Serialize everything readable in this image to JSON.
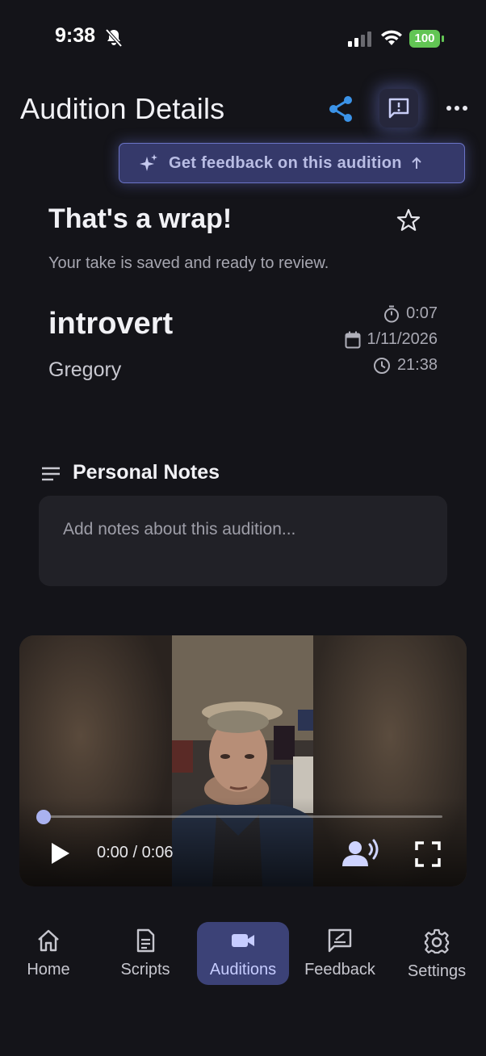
{
  "status_bar": {
    "time": "9:38",
    "battery": "100"
  },
  "header": {
    "title": "Audition Details",
    "feedback_banner": "Get feedback on this audition"
  },
  "wrap": {
    "title": "That's a wrap!",
    "subtitle": "Your take is saved and ready to review."
  },
  "audition": {
    "script_title": "introvert",
    "character": "Gregory",
    "duration": "0:07",
    "date": "1/11/2026",
    "time": "21:38"
  },
  "notes": {
    "heading": "Personal Notes",
    "placeholder": "Add notes about this audition...",
    "value": ""
  },
  "video": {
    "time_display": "0:00 / 0:06",
    "progress": 0
  },
  "nav": {
    "items": [
      {
        "label": "Home",
        "icon": "home-icon"
      },
      {
        "label": "Scripts",
        "icon": "document-icon"
      },
      {
        "label": "Auditions",
        "icon": "video-camera-icon"
      },
      {
        "label": "Feedback",
        "icon": "feedback-icon"
      },
      {
        "label": "Settings",
        "icon": "gear-icon"
      }
    ],
    "active": "Auditions"
  },
  "colors": {
    "accent": "#3c4277",
    "share": "#3b93e8",
    "battery": "#62c554",
    "background": "#141419"
  }
}
